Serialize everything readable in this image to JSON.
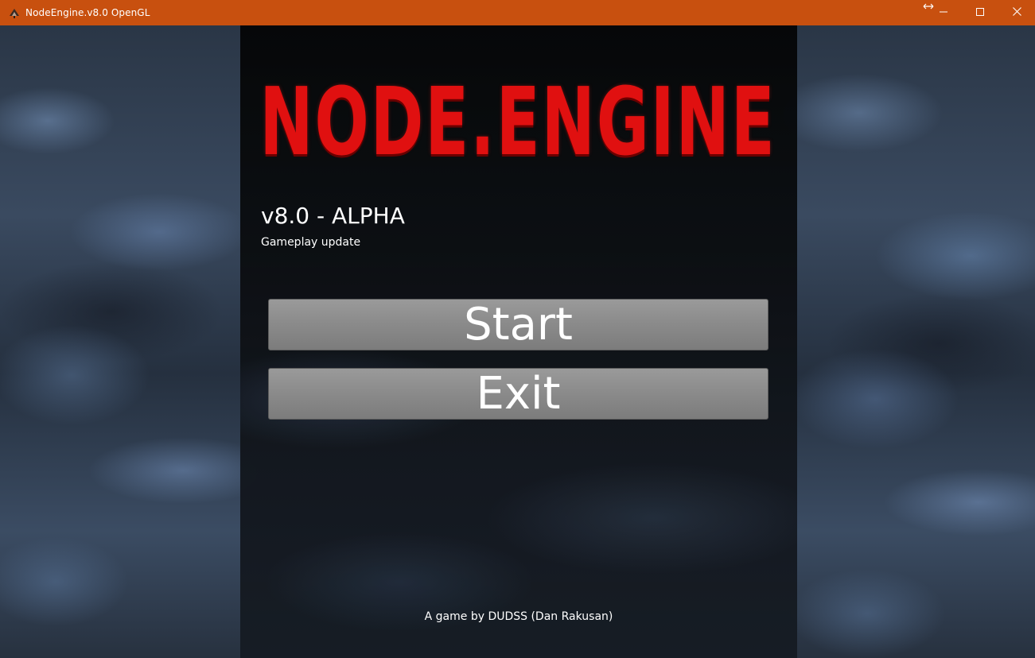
{
  "window": {
    "title": "NodeEngine.v8.0 OpenGL",
    "title_bar_color": "#c8500f",
    "icons": {
      "app": "game-app-icon",
      "minimize": "minimize-icon",
      "maximize": "maximize-icon",
      "close": "close-icon"
    }
  },
  "game": {
    "logo_text": "NODE.ENGINE",
    "logo_color": "#e01010",
    "version": "v8.0 - ALPHA",
    "subtitle": "Gameplay update",
    "menu": {
      "start_label": "Start",
      "exit_label": "Exit"
    },
    "credits": "A game by DUDSS (Dan Rakusan)"
  }
}
